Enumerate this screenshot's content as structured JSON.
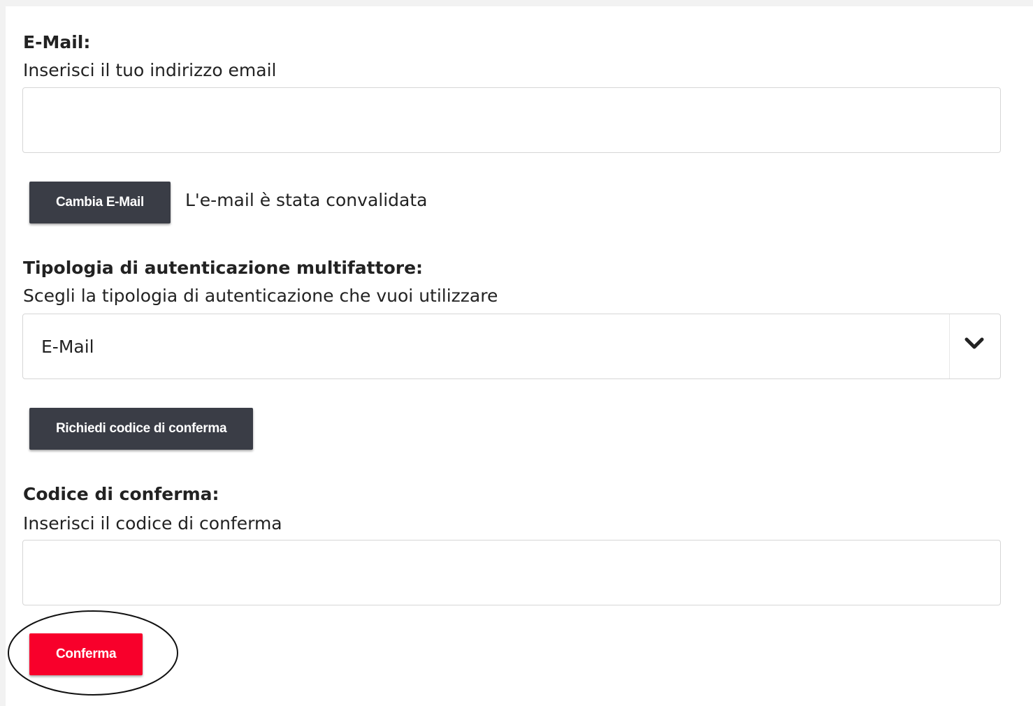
{
  "email_section": {
    "title": "E-Mail:",
    "description": "Inserisci il tuo indirizzo email",
    "input_value": "",
    "change_button_label": "Cambia E-Mail",
    "status_text": "L'e-mail è stata convalidata"
  },
  "mfa_section": {
    "title": "Tipologia di autenticazione multifattore:",
    "description": "Scegli la tipologia di autenticazione che vuoi utilizzare",
    "selected_value": "E-Mail",
    "request_button_label": "Richiedi codice di conferma"
  },
  "code_section": {
    "title": "Codice di conferma:",
    "description": "Inserisci il codice di conferma",
    "input_value": "",
    "confirm_button_label": "Conferma"
  },
  "icons": {
    "select_arrow": "chevron-down-icon"
  },
  "colors": {
    "dark_button": "#3a3d46",
    "primary_button": "#f8002b",
    "annotation_outline": "#111111"
  }
}
